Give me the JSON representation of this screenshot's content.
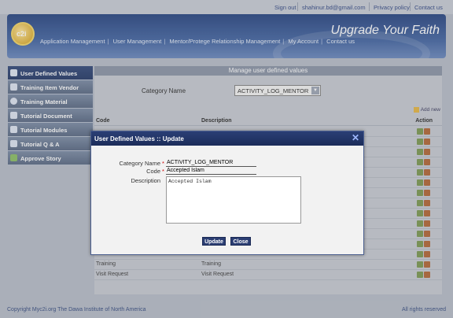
{
  "toplinks": {
    "signout": "Sign out",
    "email": "shahinur.bd@gmail.com",
    "privacy": "Privacy policy",
    "contact": "Contact us"
  },
  "header": {
    "logo_text": "c2i",
    "tagline": "Upgrade Your Faith",
    "nav": [
      "Application Management",
      "User Management",
      "Mentor/Protege Relationship Management",
      "My Account",
      "Contact us"
    ]
  },
  "sidebar": {
    "items": [
      {
        "label": "User Defined Values",
        "icon": "table-icon"
      },
      {
        "label": "Training Item Vendor",
        "icon": "home-icon"
      },
      {
        "label": "Training Material",
        "icon": "gear-icon"
      },
      {
        "label": "Tutorial Document",
        "icon": "document-icon"
      },
      {
        "label": "Tutorial Modules",
        "icon": "document-icon"
      },
      {
        "label": "Tutorial Q & A",
        "icon": "image-icon"
      },
      {
        "label": "Approve Story",
        "icon": "check-icon"
      }
    ]
  },
  "main": {
    "title": "Manage user defined values",
    "category_label": "Category Name",
    "category_value": "ACTIVITY_LOG_MENTOR",
    "add_new": "Add new",
    "columns": {
      "code": "Code",
      "description": "Description",
      "action": "Action"
    },
    "rows": [
      {
        "code": "Training",
        "description": "Training"
      },
      {
        "code": "Visit Request",
        "description": "Visit Request"
      }
    ]
  },
  "modal": {
    "title": "User Defined Values :: Update",
    "category_label": "Category Name",
    "category_value": "ACTIVITY_LOG_MENTOR",
    "code_label": "Code",
    "code_value": "Accepted Islam",
    "description_label": "Description",
    "description_value": "Accepted Islam",
    "update_label": "Update",
    "close_label": "Close"
  },
  "footer": {
    "copyright": "Copyright Myc2i.org The Dawa Institute of North America",
    "rights": "All rights reserved"
  }
}
